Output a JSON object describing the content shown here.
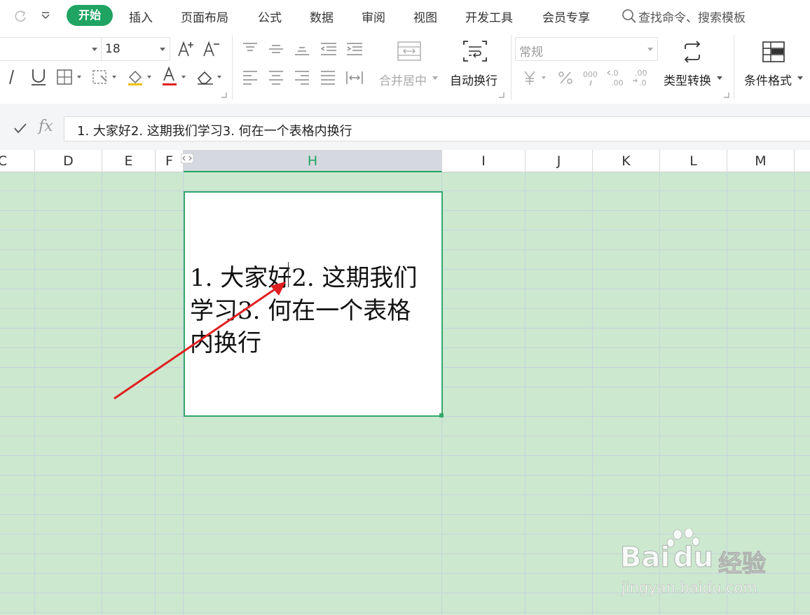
{
  "menu": {
    "active_tab": "开始",
    "tabs": [
      "插入",
      "页面布局",
      "公式",
      "数据",
      "审阅",
      "视图",
      "开发工具",
      "会员专享"
    ],
    "search_placeholder": "查找命令、搜索模板"
  },
  "ribbon": {
    "font_name_partial": " ",
    "font_size": "18",
    "merge_center_label": "合并居中",
    "wrap_text_label": "自动换行",
    "number_format": "常规",
    "type_convert_label": "类型转换",
    "conditional_format_label": "条件格式"
  },
  "formula_bar": {
    "fx_label": "fx",
    "content": "1. 大家好2. 这期我们学习3. 何在一个表格内换行"
  },
  "columns": [
    {
      "label": "C"
    },
    {
      "label": "D"
    },
    {
      "label": "E"
    },
    {
      "label": "F"
    },
    {
      "label": "H"
    },
    {
      "label": "I"
    },
    {
      "label": "J"
    },
    {
      "label": "K"
    },
    {
      "label": "L"
    },
    {
      "label": "M"
    }
  ],
  "cell": {
    "lines": [
      "1. 大家好2. 这期我们",
      "学习3. 何在一个表格",
      "内换行"
    ]
  },
  "watermark": {
    "brand": "Bai",
    "brand2": "du",
    "brand_cn": "经验",
    "url": "jingyan.baidu.com"
  },
  "colors": {
    "accent": "#1fa463",
    "grid_bg": "#cce8cf",
    "arrow": "#e02020"
  }
}
